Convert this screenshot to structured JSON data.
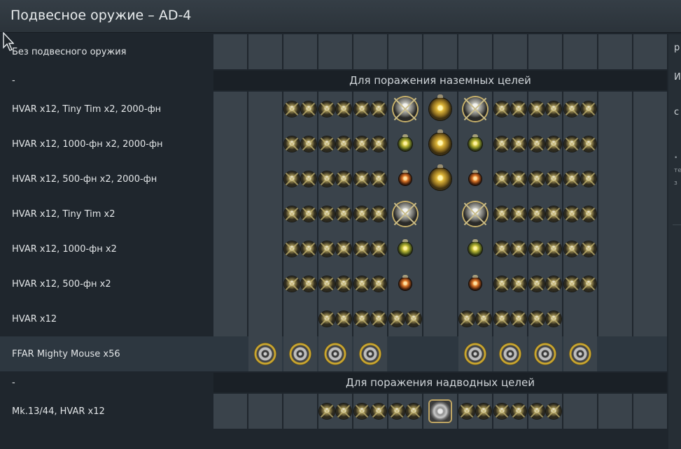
{
  "window": {
    "title": "Подвесное оружие – AD-4"
  },
  "side_panel": {
    "t1": "р",
    "t2": "И",
    "t3": "с",
    "t4": "•",
    "t5": "те",
    "t6": "з"
  },
  "rows": [
    {
      "kind": "preset",
      "label": "Без подвесного оружия",
      "slots": [
        "",
        "",
        "",
        "",
        "",
        "",
        "",
        "",
        "",
        "",
        "",
        "",
        ""
      ]
    },
    {
      "kind": "header",
      "label": "-",
      "title": "Для поражения наземных целей"
    },
    {
      "kind": "preset",
      "label": "HVAR x12,  Tiny Tim x2,  2000-фн",
      "slots": [
        "",
        "",
        "rkt2",
        "rkt2",
        "rkt2",
        "tinytim",
        "bomb2000",
        "tinytim",
        "rkt2",
        "rkt2",
        "rkt2",
        "",
        ""
      ]
    },
    {
      "kind": "preset",
      "label": "HVAR x12,  1000-фн x2,  2000-фн",
      "slots": [
        "",
        "",
        "rkt2",
        "rkt2",
        "rkt2",
        "bomb1000",
        "bomb2000",
        "bomb1000",
        "rkt2",
        "rkt2",
        "rkt2",
        "",
        ""
      ]
    },
    {
      "kind": "preset",
      "label": "HVAR x12,  500-фн x2,  2000-фн",
      "slots": [
        "",
        "",
        "rkt2",
        "rkt2",
        "rkt2",
        "bomb500",
        "bomb2000",
        "bomb500",
        "rkt2",
        "rkt2",
        "rkt2",
        "",
        ""
      ]
    },
    {
      "kind": "preset",
      "label": "HVAR x12,  Tiny Tim x2",
      "slots": [
        "",
        "",
        "rkt2",
        "rkt2",
        "rkt2",
        "tinytim",
        "",
        "tinytim",
        "rkt2",
        "rkt2",
        "rkt2",
        "",
        ""
      ]
    },
    {
      "kind": "preset",
      "label": "HVAR x12,  1000-фн x2",
      "slots": [
        "",
        "",
        "rkt2",
        "rkt2",
        "rkt2",
        "bomb1000",
        "",
        "bomb1000",
        "rkt2",
        "rkt2",
        "rkt2",
        "",
        ""
      ]
    },
    {
      "kind": "preset",
      "label": "HVAR x12,  500-фн x2",
      "slots": [
        "",
        "",
        "rkt2",
        "rkt2",
        "rkt2",
        "bomb500",
        "",
        "bomb500",
        "rkt2",
        "rkt2",
        "rkt2",
        "",
        ""
      ]
    },
    {
      "kind": "preset",
      "label": "HVAR x12",
      "slots": [
        "",
        "",
        "",
        "rkt2",
        "rkt2",
        "rkt2",
        "",
        "rkt2",
        "rkt2",
        "rkt2",
        "",
        "",
        ""
      ]
    },
    {
      "kind": "preset",
      "label": "FFAR Mighty Mouse x56",
      "selected": true,
      "slots": [
        "x",
        "ffar",
        "ffar",
        "ffar",
        "ffar",
        "x",
        "x",
        "ffar",
        "ffar",
        "ffar",
        "ffar",
        "x",
        "x"
      ]
    },
    {
      "kind": "header",
      "label": "-",
      "title": "Для поражения надводных целей"
    },
    {
      "kind": "preset",
      "label": "Mk.13/44,  HVAR x12",
      "slots": [
        "",
        "",
        "",
        "rkt2",
        "rkt2",
        "rkt2",
        "torpedo",
        "rkt2",
        "rkt2",
        "rkt2",
        "",
        "",
        ""
      ]
    }
  ]
}
